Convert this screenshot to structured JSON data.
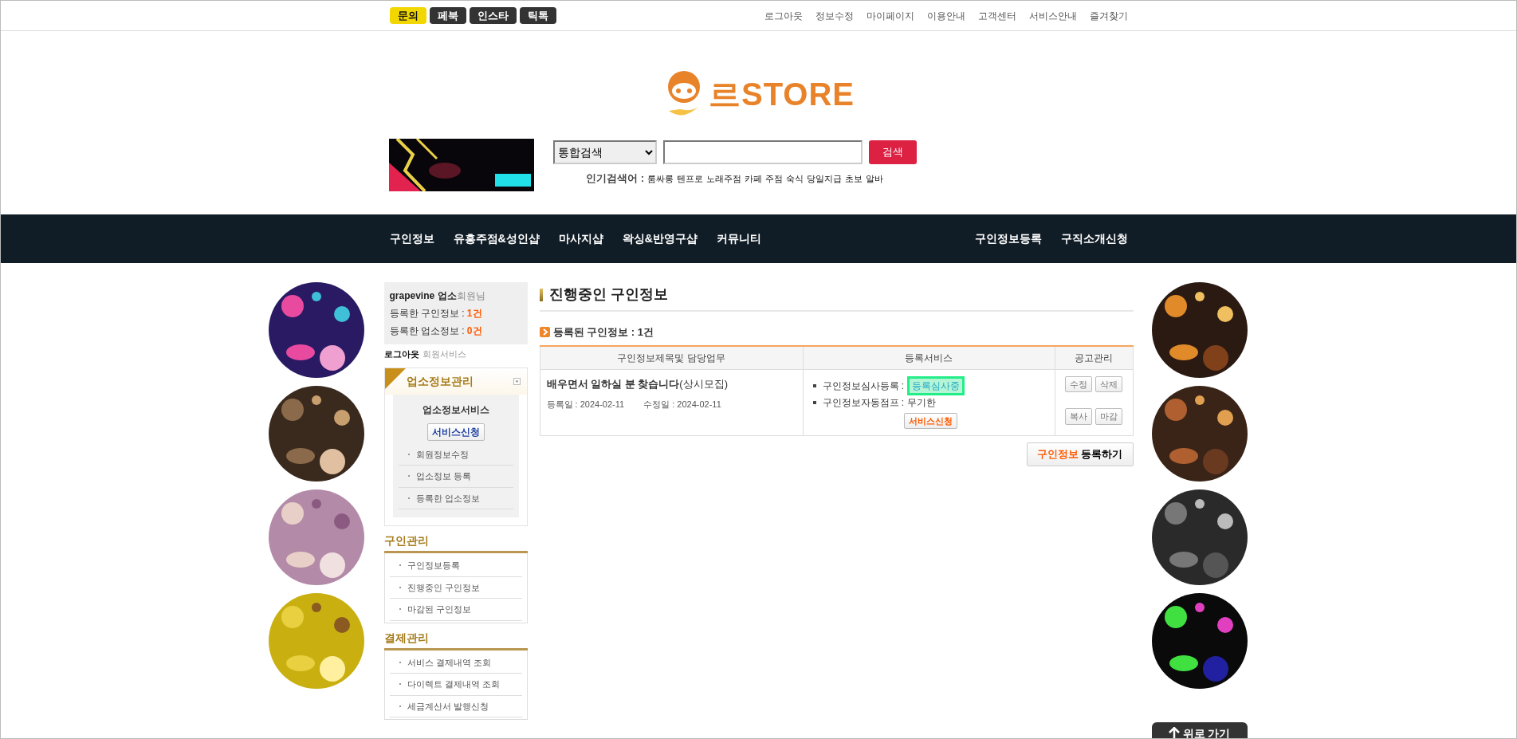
{
  "top_buttons": [
    {
      "label": "문의",
      "color": "#f2d600"
    },
    {
      "label": "페북",
      "color": "#333333"
    },
    {
      "label": "인스타",
      "color": "#333333"
    },
    {
      "label": "틱톡",
      "color": "#333333"
    }
  ],
  "top_links": [
    "로그아웃",
    "정보수정",
    "마이페이지",
    "이용안내",
    "고객센터",
    "서비스안내",
    "즐겨찾기"
  ],
  "logo": {
    "text": "르STORE"
  },
  "search": {
    "scope": "통합검색",
    "button": "검색"
  },
  "popular": {
    "label": "인기검색어 :",
    "terms": [
      "룸싸롱",
      "텐프로",
      "노래주점",
      "카페",
      "주점",
      "숙식",
      "당일지급",
      "초보",
      "알바"
    ]
  },
  "nav": {
    "left": [
      "구인정보",
      "유흥주점&성인샵",
      "마사지샵",
      "왁싱&반영구샵",
      "커뮤니티"
    ],
    "right": [
      "구인정보등록",
      "구직소개신청"
    ]
  },
  "scroll_top": "위로 가기",
  "sidebar": {
    "user": "grapevine 업소",
    "suffix": "회원님",
    "stats": [
      {
        "label": "등록한 구인정보 :",
        "value": "1건"
      },
      {
        "label": "등록한 업소정보 :",
        "value": "0건"
      }
    ],
    "logout": "로그아웃",
    "member_service": "회원서비스",
    "business": {
      "title": "업소정보관리",
      "panel_title": "업소정보서비스",
      "button": "서비스신청",
      "links": [
        "회원정보수정",
        "업소정보 등록",
        "등록한 업소정보"
      ]
    },
    "sections": [
      {
        "title": "구인관리",
        "links": [
          "구인정보등록",
          "진행중인 구인정보",
          "마감된 구인정보"
        ]
      },
      {
        "title": "결제관리",
        "links": [
          "서비스 결제내역 조회",
          "다이렉트 결제내역 조회",
          "세금계산서 발행신청"
        ]
      }
    ]
  },
  "main": {
    "title": "진행중인 구인정보",
    "count_label": "등록된 구인정보 : 1건",
    "table": {
      "columns": [
        "구인정보제목및 담당업무",
        "등록서비스",
        "공고관리"
      ],
      "rows": [
        {
          "title": "**배우면서 일하실 분 찾습니다**(상시모집)",
          "registered": "등록일 : 2024-02-11",
          "modified": "수정일 : 2024-02-11",
          "services": [
            {
              "label": "구인정보심사등록 :",
              "value": "등록심사중",
              "highlighted": true
            },
            {
              "label": "구인정보자동점프 :",
              "value": "무기한",
              "highlighted": false
            }
          ],
          "service_button": "서비스신청",
          "actions": [
            "수정",
            "삭제",
            "복사",
            "마감"
          ]
        }
      ]
    },
    "register_button": {
      "accent": "구인정보",
      "text": "등록하기"
    }
  }
}
